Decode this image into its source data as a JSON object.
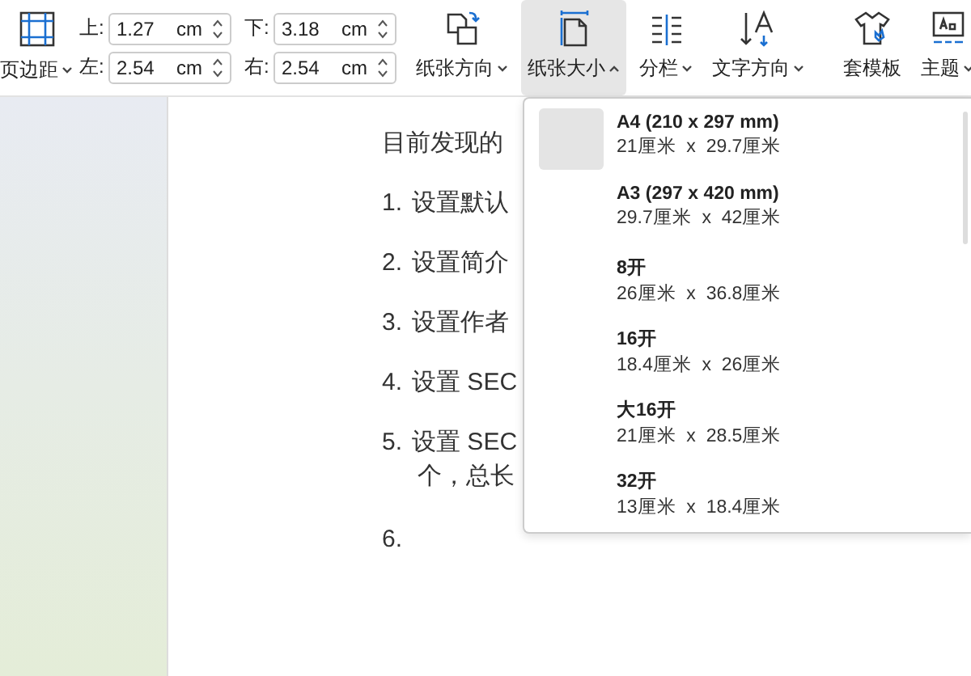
{
  "toolbar": {
    "margins": {
      "label": "页边距",
      "fields": [
        {
          "label": "上:",
          "value": "1.27",
          "unit": "cm"
        },
        {
          "label": "下:",
          "value": "3.18",
          "unit": "cm"
        },
        {
          "label": "左:",
          "value": "2.54",
          "unit": "cm"
        },
        {
          "label": "右:",
          "value": "2.54",
          "unit": "cm"
        }
      ]
    },
    "buttons": [
      {
        "label": "纸张方向",
        "kind": "menu",
        "selected": false,
        "expanded": false
      },
      {
        "label": "纸张大小",
        "kind": "menu",
        "selected": true,
        "expanded": true
      },
      {
        "label": "分栏",
        "kind": "menu",
        "selected": false,
        "expanded": false
      },
      {
        "label": "文字方向",
        "kind": "menu",
        "selected": false,
        "expanded": false
      },
      {
        "label": "套模板",
        "kind": "plain",
        "selected": false
      },
      {
        "label": "主题",
        "kind": "menu",
        "selected": false,
        "expanded": false
      }
    ]
  },
  "paper_sizes": [
    {
      "name": "A4 (210 x 297 mm)",
      "size": "21厘米  x  29.7厘米",
      "selected": true
    },
    {
      "name": "A3 (297 x 420 mm)",
      "size": "29.7厘米  x  42厘米",
      "selected": false
    },
    {
      "name": "8开",
      "size": "26厘米  x  36.8厘米",
      "selected": false
    },
    {
      "name": "16开",
      "size": "18.4厘米  x  26厘米",
      "selected": false
    },
    {
      "name": "大16开",
      "size": "21厘米  x  28.5厘米",
      "selected": false
    },
    {
      "name": "32开",
      "size": "13厘米  x  18.4厘米",
      "selected": false
    }
  ],
  "document": {
    "lines": [
      {
        "text": "目前发现的"
      },
      {
        "number": "1.",
        "text": "设置默认"
      },
      {
        "number": "2.",
        "text": "设置简介"
      },
      {
        "number": "3.",
        "text": "设置作者"
      },
      {
        "number": "4.",
        "text": "设置 SEC"
      },
      {
        "number": "5.",
        "text": "设置 SEC"
      },
      {
        "text": "个，总长",
        "kind": "continuation"
      },
      {
        "number": "6."
      }
    ]
  }
}
